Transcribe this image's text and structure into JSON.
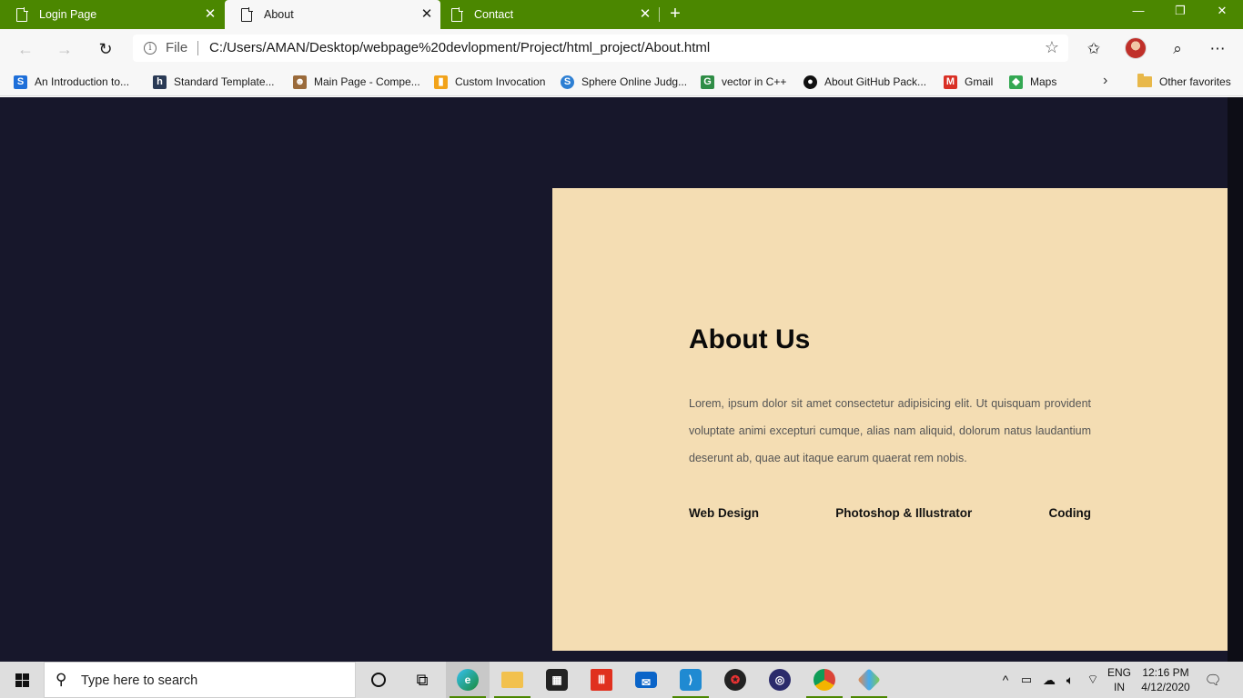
{
  "browser": {
    "tabs": [
      {
        "title": "Login Page",
        "close": "✕",
        "active": false
      },
      {
        "title": "About",
        "close": "✕",
        "active": true
      },
      {
        "title": "Contact",
        "close": "✕",
        "active": false
      }
    ],
    "new_tab": "+",
    "window_controls": {
      "minimize": "—",
      "restore": "❐",
      "close": "✕"
    },
    "address": {
      "scheme_label": "File",
      "url": "C:/Users/AMAN/Desktop/webpage%20devlopment/Project/html_project/About.html"
    },
    "favorites": [
      {
        "label": "An Introduction to...",
        "icon": "s-icon",
        "color": "#1e6fd9",
        "glyph": "S"
      },
      {
        "label": "Standard Template...",
        "icon": "h-icon",
        "color": "#2a3a55",
        "glyph": "h"
      },
      {
        "label": "Main Page - Compe...",
        "icon": "monkey-icon",
        "color": "#9a6a3a",
        "glyph": "☻"
      },
      {
        "label": "Custom Invocation",
        "icon": "bar-chart-icon",
        "color": "#f2a31a",
        "glyph": "▮"
      },
      {
        "label": "Sphere Online Judg...",
        "icon": "sphere-icon",
        "color": "#2d7fd3",
        "glyph": "S"
      },
      {
        "label": "vector in C++",
        "icon": "gfg-icon",
        "color": "#2f8d46",
        "glyph": "G"
      },
      {
        "label": "About GitHub Pack...",
        "icon": "github-icon",
        "color": "#111111",
        "glyph": "●"
      },
      {
        "label": "Gmail",
        "icon": "gmail-icon",
        "color": "#d93025",
        "glyph": "M"
      },
      {
        "label": "Maps",
        "icon": "maps-icon",
        "color": "#34a853",
        "glyph": "◆"
      }
    ],
    "favorites_more": "›",
    "other_favorites": "Other favorites"
  },
  "page": {
    "background_color": "#17172b",
    "card_color": "#f4ddb3",
    "title": "About Us",
    "paragraph": "Lorem, ipsum dolor sit amet consectetur adipisicing elit. Ut quisquam provident voluptate animi excepturi cumque, alias nam aliquid, dolorum natus laudantium deserunt ab, quae aut itaque earum quaerat rem nobis.",
    "skills": [
      "Web Design",
      "Photoshop & Illustrator",
      "Coding"
    ]
  },
  "taskbar": {
    "search_placeholder": "Type here to search",
    "language": "ENG",
    "region": "IN",
    "time": "12:16 PM",
    "date": "4/12/2020",
    "accent_color": "#4b8700"
  }
}
